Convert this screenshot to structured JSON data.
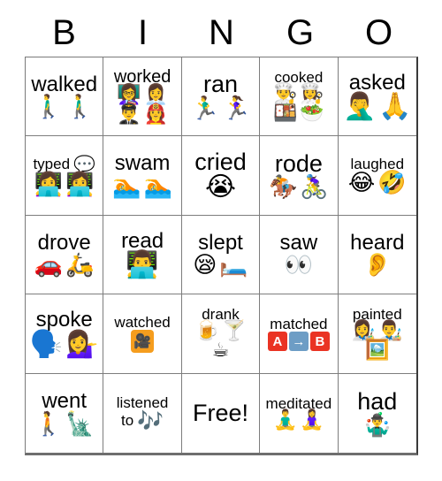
{
  "header": {
    "letters": [
      "B",
      "I",
      "N",
      "G",
      "O"
    ]
  },
  "colors": {
    "grid_line": "#7d7d7d",
    "grid_outer": "#3a3a3a",
    "text": "#000000",
    "background": "#ffffff",
    "block_red": "#ea3323",
    "block_blue": "#6d9dc5",
    "projector_orange": "#f59d1e"
  },
  "grid": {
    "columns": 5,
    "rows": 5,
    "cells": [
      {
        "id": "b1",
        "word": "walked",
        "word_size": "w-lg",
        "inline_emoji": "",
        "emoji": [
          "🚶‍♂️",
          "🚶‍♂️"
        ],
        "emoji_names": [
          "person-walking-icon",
          "person-walking-icon"
        ],
        "emoji_size": "e-md",
        "layout": "row",
        "free": false
      },
      {
        "id": "i1",
        "word": "worked",
        "word_size": "w-md",
        "inline_emoji": "",
        "emoji": [
          "👩‍🏫",
          "👩‍💼",
          "👨‍✈️",
          "👩‍🚒"
        ],
        "emoji_names": [
          "teacher-icon",
          "office-worker-icon",
          "pilot-icon",
          "firefighter-icon"
        ],
        "emoji_size": "e-sm",
        "layout": "grid2x2",
        "free": false
      },
      {
        "id": "n1",
        "word": "ran",
        "word_size": "w-xl",
        "inline_emoji": "",
        "emoji": [
          "🏃‍♂️",
          "🏃‍♀️"
        ],
        "emoji_names": [
          "man-running-icon",
          "woman-running-icon"
        ],
        "emoji_size": "e-md",
        "layout": "row",
        "free": false
      },
      {
        "id": "g1",
        "word": "cooked",
        "word_size": "w-sm",
        "inline_emoji": "",
        "emoji": [
          "👨‍🍳",
          "👩‍🍳",
          "🍱",
          "🥗"
        ],
        "emoji_names": [
          "man-cook-icon",
          "woman-cook-icon",
          "bento-box-icon",
          "green-salad-icon"
        ],
        "emoji_size": "e-sm",
        "layout": "grid2x2",
        "free": false
      },
      {
        "id": "o1",
        "word": "asked",
        "word_size": "w-lg",
        "inline_emoji": "",
        "emoji": [
          "🤦‍♂️",
          "🙏"
        ],
        "emoji_names": [
          "person-facepalming-icon",
          "folded-hands-icon"
        ],
        "emoji_size": "e-lg",
        "layout": "row",
        "free": false
      },
      {
        "id": "b2",
        "word": "typed",
        "word_size": "w-sm",
        "inline_emoji": "💬",
        "inline_emoji_name": "speech-balloon-icon",
        "emoji": [
          "👩‍💻",
          "👩‍💻"
        ],
        "emoji_names": [
          "technologist-icon",
          "technologist-icon"
        ],
        "emoji_size": "e-md",
        "layout": "row",
        "free": false
      },
      {
        "id": "i2",
        "word": "swam",
        "word_size": "w-lg",
        "inline_emoji": "",
        "emoji": [
          "🏊",
          "🏊"
        ],
        "emoji_names": [
          "person-swimming-icon",
          "person-swimming-icon"
        ],
        "emoji_size": "e-md",
        "layout": "row",
        "free": false
      },
      {
        "id": "n2",
        "word": "cried",
        "word_size": "w-xl",
        "inline_emoji": "",
        "emoji": [
          "😭"
        ],
        "emoji_names": [
          "loudly-crying-face-icon"
        ],
        "emoji_size": "e-lg",
        "layout": "row",
        "free": false
      },
      {
        "id": "g2",
        "word": "rode",
        "word_size": "w-xl",
        "inline_emoji": "",
        "emoji": [
          "🏇",
          "🚴‍♀️"
        ],
        "emoji_names": [
          "horse-racing-icon",
          "woman-biking-icon"
        ],
        "emoji_size": "e-md",
        "layout": "row",
        "free": false
      },
      {
        "id": "o2",
        "word": "laughed",
        "word_size": "w-sm",
        "inline_emoji": "",
        "emoji": [
          "😂",
          "🤣"
        ],
        "emoji_names": [
          "face-with-tears-of-joy-icon",
          "rolling-on-the-floor-laughing-icon"
        ],
        "emoji_size": "e-md",
        "layout": "row",
        "free": false
      },
      {
        "id": "b3",
        "word": "drove",
        "word_size": "w-lg",
        "inline_emoji": "",
        "emoji": [
          "🚗",
          "🛵"
        ],
        "emoji_names": [
          "automobile-icon",
          "motor-scooter-icon"
        ],
        "emoji_size": "e-md",
        "layout": "row",
        "free": false
      },
      {
        "id": "i3",
        "word": "read",
        "word_size": "w-lg",
        "inline_emoji": "",
        "emoji": [
          "👨‍💻"
        ],
        "emoji_names": [
          "man-technologist-icon"
        ],
        "emoji_size": "e-lg",
        "layout": "row",
        "free": false
      },
      {
        "id": "n3",
        "word": "slept",
        "word_size": "w-lg",
        "inline_emoji": "",
        "emoji": [
          "😪",
          "🛏️"
        ],
        "emoji_names": [
          "sleepy-face-icon",
          "bed-icon"
        ],
        "emoji_size": "e-md",
        "layout": "row",
        "free": false
      },
      {
        "id": "g3",
        "word": "saw",
        "word_size": "w-lg",
        "inline_emoji": "",
        "emoji": [
          "👀"
        ],
        "emoji_names": [
          "eyes-icon"
        ],
        "emoji_size": "e-md",
        "layout": "row",
        "free": false
      },
      {
        "id": "o3",
        "word": "heard",
        "word_size": "w-lg",
        "inline_emoji": "",
        "emoji": [
          "👂"
        ],
        "emoji_names": [
          "ear-icon"
        ],
        "emoji_size": "e-md",
        "layout": "row",
        "free": false
      },
      {
        "id": "b4",
        "word": "spoke",
        "word_size": "w-lg",
        "inline_emoji": "",
        "emoji": [
          "🗣️",
          "💁‍♀️"
        ],
        "emoji_names": [
          "speaking-head-icon",
          "woman-tipping-hand-icon"
        ],
        "emoji_size": "e-lg",
        "layout": "row",
        "free": false
      },
      {
        "id": "i4",
        "word": "watched",
        "word_size": "w-sm",
        "inline_emoji": "",
        "emoji": [
          "projector"
        ],
        "emoji_names": [
          "film-projector-icon"
        ],
        "emoji_size": "e-md",
        "layout": "projector",
        "free": false
      },
      {
        "id": "n4",
        "word": "drank",
        "word_size": "w-sm",
        "inline_emoji": "",
        "emoji": [
          "🍺",
          "🍸",
          "☕"
        ],
        "emoji_names": [
          "beer-mug-icon",
          "cocktail-glass-icon",
          "hot-beverage-icon"
        ],
        "emoji_size": "e-sm",
        "layout": "drank",
        "free": false
      },
      {
        "id": "g4",
        "word": "matched",
        "word_size": "w-sm",
        "inline_emoji": "",
        "emoji": [
          "A",
          "→",
          "B"
        ],
        "emoji_names": [
          "letter-a-block-icon",
          "right-arrow-icon",
          "letter-b-block-icon"
        ],
        "emoji_size": "e-sm",
        "layout": "ab",
        "free": false
      },
      {
        "id": "o4",
        "word": "painted",
        "word_size": "w-sm",
        "inline_emoji": "",
        "emoji": [
          "👩‍🎨",
          "👨‍🎨",
          "🖼️"
        ],
        "emoji_names": [
          "woman-artist-icon",
          "man-artist-icon",
          "framed-picture-icon"
        ],
        "emoji_size": "e-sm",
        "layout": "painted",
        "free": false
      },
      {
        "id": "b5",
        "word": "went",
        "word_size": "w-lg",
        "inline_emoji": "",
        "emoji": [
          "🚶",
          "🗽"
        ],
        "emoji_names": [
          "person-walking-icon",
          "statue-of-liberty-icon"
        ],
        "emoji_size": "e-md",
        "layout": "row",
        "free": false
      },
      {
        "id": "i5",
        "word": "listened",
        "word_size": "w-sm",
        "word_line2": "to",
        "inline_emoji": "🎶",
        "inline_emoji_name": "musical-notes-icon",
        "emoji": [],
        "emoji_names": [],
        "emoji_size": "e-md",
        "layout": "listened",
        "free": false
      },
      {
        "id": "n5",
        "word": "Free!",
        "word_size": "w-xl",
        "inline_emoji": "",
        "emoji": [],
        "emoji_names": [],
        "emoji_size": "e-md",
        "layout": "none",
        "free": true
      },
      {
        "id": "g5",
        "word": "meditated",
        "word_size": "w-sm",
        "inline_emoji": "",
        "emoji": [
          "🧘‍♂️",
          "🧘‍♀️"
        ],
        "emoji_names": [
          "man-in-lotus-position-icon",
          "woman-in-lotus-position-icon"
        ],
        "emoji_size": "e-sm",
        "layout": "row",
        "free": false
      },
      {
        "id": "o5",
        "word": "had",
        "word_size": "w-xl",
        "inline_emoji": "",
        "emoji": [
          "🤹‍♂️"
        ],
        "emoji_names": [
          "man-juggling-icon"
        ],
        "emoji_size": "e-md",
        "layout": "row",
        "free": false
      }
    ]
  }
}
